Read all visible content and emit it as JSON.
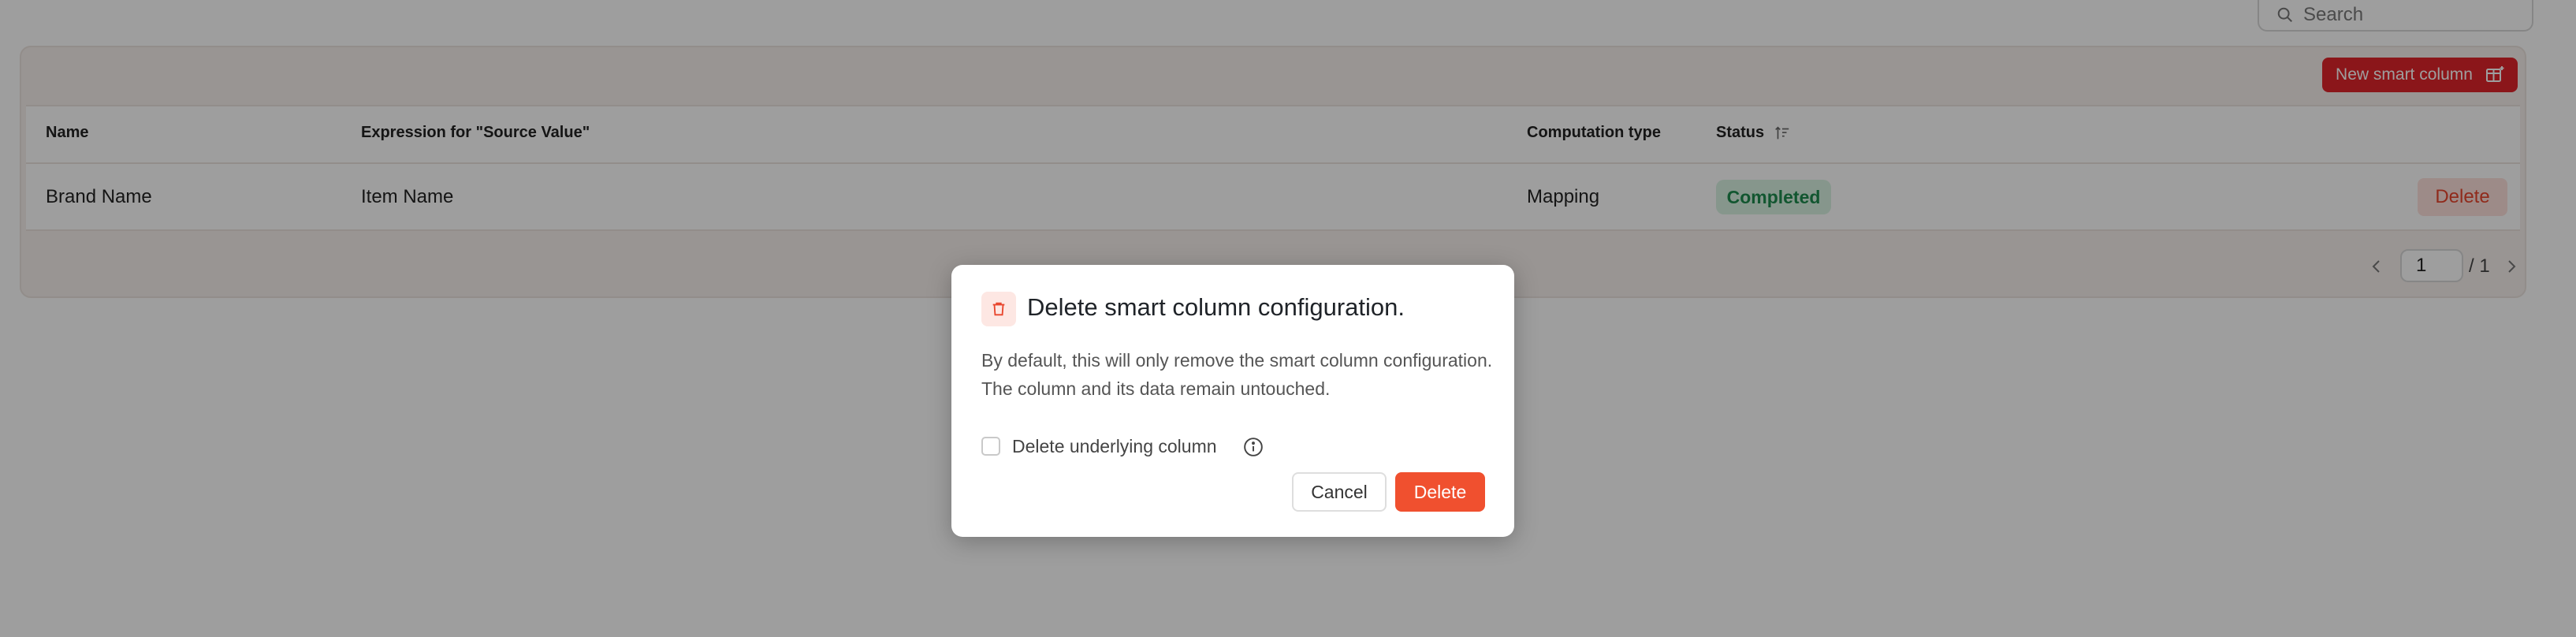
{
  "search": {
    "placeholder": "Search",
    "icon": "search-icon"
  },
  "toolbar": {
    "new_smart_column_label": "New smart column",
    "new_smart_column_icon": "add-column-icon"
  },
  "table": {
    "columns": [
      "Name",
      "Expression for \"Source Value\"",
      "Computation type",
      "Status"
    ],
    "rows": [
      {
        "name": "Brand Name",
        "expression": "Item Name",
        "computation_type": "Mapping",
        "status": "Completed",
        "action": "Delete"
      }
    ]
  },
  "pagination": {
    "current_page": "1",
    "total": "/ 1"
  },
  "modal": {
    "title": "Delete smart column configuration.",
    "body": "By default, this will only remove the smart column configuration. The column and its data remain untouched.",
    "checkbox_label": "Delete underlying column",
    "cancel_label": "Cancel",
    "delete_label": "Delete"
  },
  "colors": {
    "brand_red": "#e0242a",
    "danger": "#f0502f",
    "success_text": "#1e8c4e",
    "success_bg": "#d8f2e2"
  }
}
